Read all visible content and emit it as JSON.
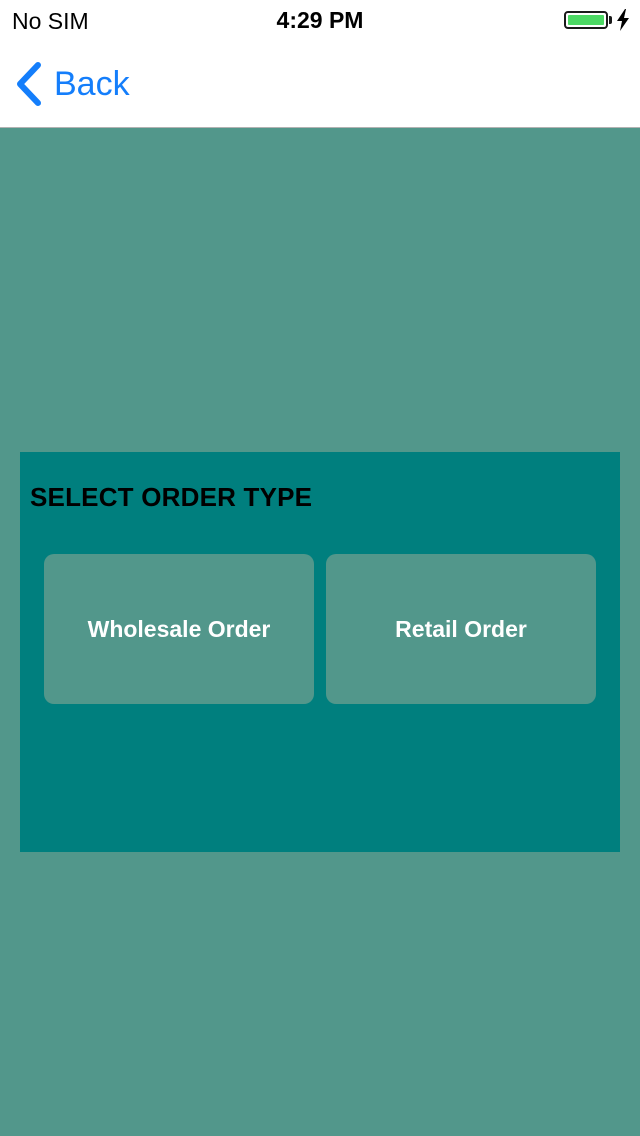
{
  "status_bar": {
    "carrier": "No SIM",
    "time": "4:29 PM",
    "battery_level": 1.0,
    "battery_color": "#4cd964",
    "charging": true
  },
  "nav": {
    "back_label": "Back",
    "back_icon": "chevron-left-icon",
    "accent_color": "#147efb"
  },
  "panel": {
    "title": "SELECT ORDER TYPE",
    "background_color": "#007f7e",
    "buttons": [
      {
        "label": "Wholesale Order"
      },
      {
        "label": "Retail Order"
      }
    ]
  },
  "theme": {
    "page_background": "#52978b",
    "button_background": "#52978b",
    "button_text_color": "#ffffff"
  }
}
